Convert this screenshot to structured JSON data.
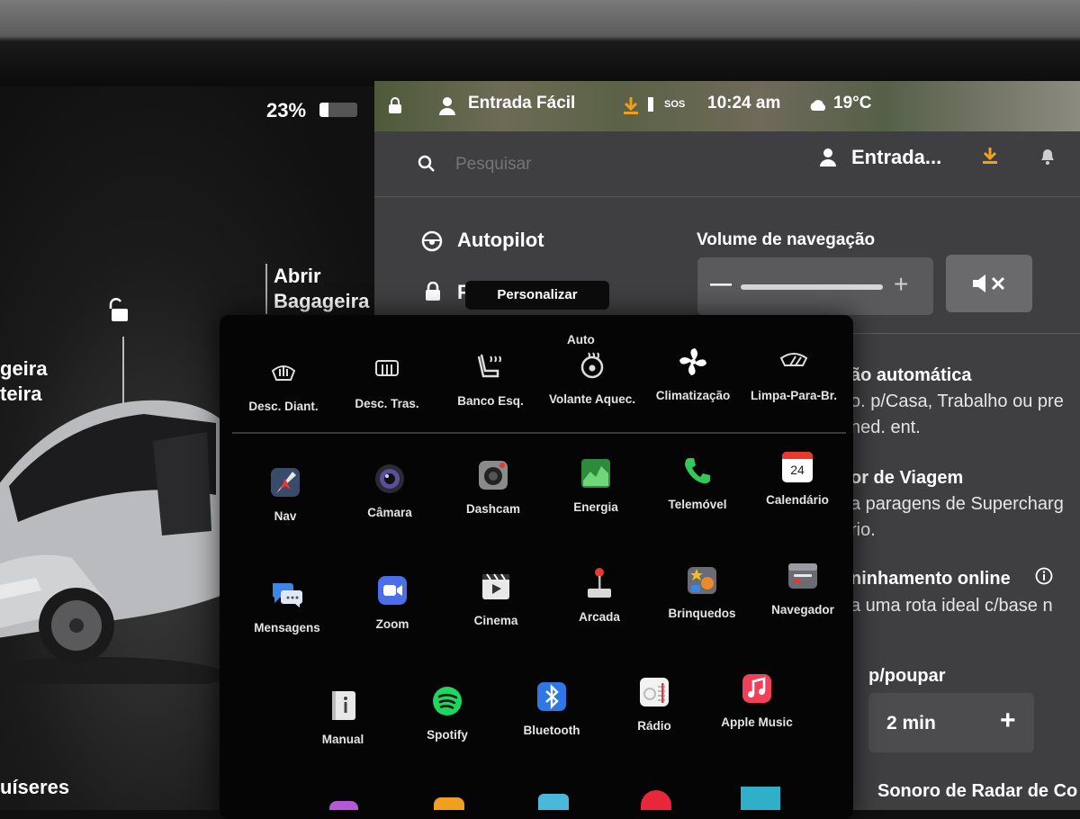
{
  "status_bar": {
    "battery_percent": "23%",
    "battery_fill": 0.23,
    "profile": "Entrada Fácil",
    "sos": "SOS",
    "time": "10:24 am",
    "temperature": "19°C"
  },
  "car": {
    "trunk_label_1": "Abrir",
    "trunk_label_2": "Bagageira",
    "frunk_label_1": "geira",
    "frunk_label_2": "teira",
    "cruise_label": "uíseres"
  },
  "header": {
    "search_placeholder": "Pesquisar",
    "user_name": "Entrada..."
  },
  "menu": [
    {
      "label": "Autopilot"
    },
    {
      "label": "F"
    }
  ],
  "tooltip": "Personalizar",
  "volume": {
    "title": "Volume de navegação",
    "minus": "—",
    "plus": "+"
  },
  "right_panel": {
    "line1": "ão automática",
    "line2": "o. p/Casa, Trabalho ou pre",
    "line3": "ned. ent.",
    "line4": "or de Viagem",
    "line5": "a paragens de Supercharg",
    "line6": "rio.",
    "line7": "ninhamento online",
    "line8": "a uma rota ideal c/base n",
    "line9": "p/poupar",
    "stepper_value": "2 min",
    "stepper_plus": "+",
    "line10": "Sonoro de Radar de Co"
  },
  "quick_controls": [
    {
      "label": "Desc. Diant.",
      "icon": "front-defrost-icon"
    },
    {
      "label": "Desc. Tras.",
      "icon": "rear-defrost-icon"
    },
    {
      "label": "Banco Esq.",
      "icon": "seat-heater-icon"
    },
    {
      "label": "Volante Aquec.",
      "icon": "steering-heater-icon",
      "tag": "Auto"
    },
    {
      "label": "Climatização",
      "icon": "fan-icon"
    },
    {
      "label": "Limpa-Para-Br.",
      "icon": "wiper-icon"
    }
  ],
  "apps_row1": [
    {
      "label": "Nav",
      "icon": "nav-icon"
    },
    {
      "label": "Câmara",
      "icon": "camera-icon"
    },
    {
      "label": "Dashcam",
      "icon": "dashcam-icon"
    },
    {
      "label": "Energia",
      "icon": "energy-icon"
    },
    {
      "label": "Telemóvel",
      "icon": "phone-icon"
    },
    {
      "label": "Calendário",
      "icon": "calendar-icon",
      "day": "24"
    }
  ],
  "apps_row2": [
    {
      "label": "Mensagens",
      "icon": "messages-icon"
    },
    {
      "label": "Zoom",
      "icon": "zoom-icon"
    },
    {
      "label": "Cinema",
      "icon": "cinema-icon"
    },
    {
      "label": "Arcada",
      "icon": "arcade-icon"
    },
    {
      "label": "Brinquedos",
      "icon": "toybox-icon"
    },
    {
      "label": "Navegador",
      "icon": "browser-icon"
    }
  ],
  "apps_row3": [
    {
      "label": "Manual",
      "icon": "manual-icon"
    },
    {
      "label": "Spotify",
      "icon": "spotify-icon"
    },
    {
      "label": "Bluetooth",
      "icon": "bluetooth-icon"
    },
    {
      "label": "Rádio",
      "icon": "radio-icon"
    },
    {
      "label": "Apple Music",
      "icon": "apple-music-icon"
    }
  ],
  "colors": {
    "panel_bg": "#3f3f41",
    "launcher_bg": "#050505",
    "accent_orange": "#f0a020",
    "energy_green": "#3aa34a",
    "phone_green": "#34c759"
  }
}
